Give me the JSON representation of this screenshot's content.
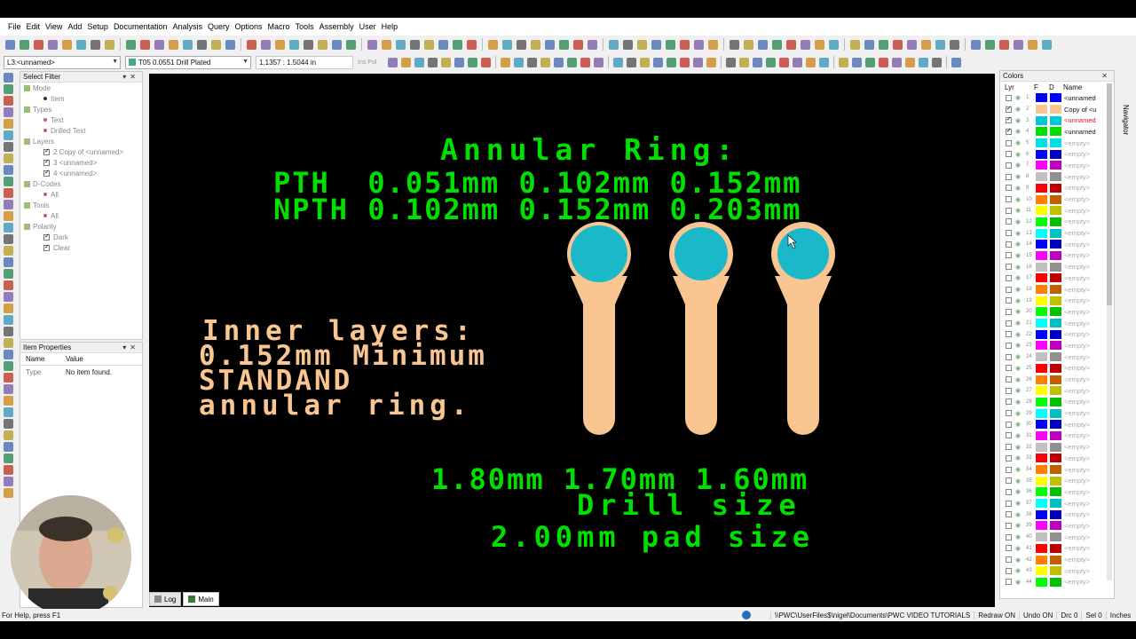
{
  "menu": [
    "File",
    "Edit",
    "View",
    "Add",
    "Setup",
    "Documentation",
    "Analysis",
    "Query",
    "Options",
    "Macro",
    "Tools",
    "Assembly",
    "User",
    "Help"
  ],
  "toolbar": {
    "layer_combo": "L3:<unnamed>",
    "tool_combo": "T05 0.0551 Drill Plated",
    "coords": "1.1357 : 1.5044 in",
    "mode_labels": "Ins  Pol"
  },
  "select_filter": {
    "title": "Select Filter",
    "rows": [
      {
        "label": "Mode",
        "level": 0,
        "kind": "group"
      },
      {
        "label": "Item",
        "level": 1,
        "kind": "radio"
      },
      {
        "label": "Types",
        "level": 0,
        "kind": "group"
      },
      {
        "label": "Text",
        "level": 1,
        "kind": "item"
      },
      {
        "label": "Drilled Text",
        "level": 1,
        "kind": "item"
      },
      {
        "label": "Layers",
        "level": 0,
        "kind": "group"
      },
      {
        "label": "2 Copy of <unnamed>",
        "level": 1,
        "kind": "check"
      },
      {
        "label": "3 <unnamed>",
        "level": 1,
        "kind": "check"
      },
      {
        "label": "4 <unnamed>",
        "level": 1,
        "kind": "check"
      },
      {
        "label": "D-Codes",
        "level": 0,
        "kind": "group"
      },
      {
        "label": "All",
        "level": 1,
        "kind": "item"
      },
      {
        "label": "Tools",
        "level": 0,
        "kind": "group"
      },
      {
        "label": "All",
        "level": 1,
        "kind": "item"
      },
      {
        "label": "Polarity",
        "level": 0,
        "kind": "group"
      },
      {
        "label": "Dark",
        "level": 1,
        "kind": "check"
      },
      {
        "label": "Clear",
        "level": 1,
        "kind": "check"
      }
    ]
  },
  "item_properties": {
    "title": "Item Properties",
    "col_name": "Name",
    "col_value": "Value",
    "row_name": "Type",
    "row_value": "No item found."
  },
  "canvas": {
    "title": "Annular Ring:",
    "line_pth": "PTH  0.051mm 0.102mm 0.152mm",
    "line_npth": "NPTH 0.102mm 0.152mm 0.203mm",
    "inner1": "Inner layers:",
    "inner2": "0.152mm Minimum",
    "inner3": "STANDAND",
    "inner4": "annular ring.",
    "drill_sizes": "1.80mm 1.70mm 1.60mm",
    "drill_label": "Drill size",
    "pad_label": "2.00mm pad size",
    "colors": {
      "text_green": "#00e000",
      "text_peach": "#f9c591",
      "pad": "#f9c591",
      "drill": "#1ab8c8"
    }
  },
  "tabs": [
    {
      "label": "Log",
      "active": false
    },
    {
      "label": "Main",
      "active": true
    }
  ],
  "colors_panel": {
    "title": "Colors",
    "headers": [
      "Lyr",
      "F",
      "D",
      "Name"
    ],
    "rows": [
      {
        "n": "1",
        "f": "#0000ff",
        "d": "#0000ff",
        "name": "<unnamed",
        "checked": false,
        "style": "dark"
      },
      {
        "n": "2",
        "f": "#f9c591",
        "d": "#f9c591",
        "name": "Copy of <u",
        "checked": true,
        "style": "dark"
      },
      {
        "n": "3",
        "f": "#00c8d8",
        "d": "#00c8d8",
        "name": "<unnamed",
        "checked": true,
        "style": "red"
      },
      {
        "n": "4",
        "f": "#00e000",
        "d": "#00e000",
        "name": "<unnamed",
        "checked": true,
        "style": "dark"
      },
      {
        "n": "5",
        "f": "#00e0e0",
        "d": "#00e0e0",
        "name": "<empty>",
        "checked": false,
        "style": "empty"
      },
      {
        "n": "6",
        "f": "#0000ff",
        "d": "#0000c0",
        "name": "<empty>",
        "checked": false,
        "style": "empty"
      },
      {
        "n": "7",
        "f": "#ff00ff",
        "d": "#c000c0",
        "name": "<empty>",
        "checked": false,
        "style": "empty"
      },
      {
        "n": "8",
        "f": "#c0c0c0",
        "d": "#909090",
        "name": "<empty>",
        "checked": false,
        "style": "empty"
      },
      {
        "n": "9",
        "f": "#ff0000",
        "d": "#c00000",
        "name": "<empty>",
        "checked": false,
        "style": "empty"
      },
      {
        "n": "10",
        "f": "#ff8000",
        "d": "#c06000",
        "name": "<empty>",
        "checked": false,
        "style": "empty"
      },
      {
        "n": "11",
        "f": "#ffff00",
        "d": "#c0c000",
        "name": "<empty>",
        "checked": false,
        "style": "empty"
      },
      {
        "n": "12",
        "f": "#00ff00",
        "d": "#00c000",
        "name": "<empty>",
        "checked": false,
        "style": "empty"
      },
      {
        "n": "13",
        "f": "#00ffff",
        "d": "#00c0c0",
        "name": "<empty>",
        "checked": false,
        "style": "empty"
      },
      {
        "n": "14",
        "f": "#0000ff",
        "d": "#0000c0",
        "name": "<empty>",
        "checked": false,
        "style": "empty"
      },
      {
        "n": "15",
        "f": "#ff00ff",
        "d": "#c000c0",
        "name": "<empty>",
        "checked": false,
        "style": "empty"
      },
      {
        "n": "16",
        "f": "#c0c0c0",
        "d": "#909090",
        "name": "<empty>",
        "checked": false,
        "style": "empty"
      },
      {
        "n": "17",
        "f": "#ff0000",
        "d": "#c00000",
        "name": "<empty>",
        "checked": false,
        "style": "empty"
      },
      {
        "n": "18",
        "f": "#ff8000",
        "d": "#c06000",
        "name": "<empty>",
        "checked": false,
        "style": "empty"
      },
      {
        "n": "19",
        "f": "#ffff00",
        "d": "#c0c000",
        "name": "<empty>",
        "checked": false,
        "style": "empty"
      },
      {
        "n": "20",
        "f": "#00ff00",
        "d": "#00c000",
        "name": "<empty>",
        "checked": false,
        "style": "empty"
      },
      {
        "n": "21",
        "f": "#00ffff",
        "d": "#00c0c0",
        "name": "<empty>",
        "checked": false,
        "style": "empty"
      },
      {
        "n": "22",
        "f": "#0000ff",
        "d": "#0000c0",
        "name": "<empty>",
        "checked": false,
        "style": "empty"
      },
      {
        "n": "23",
        "f": "#ff00ff",
        "d": "#c000c0",
        "name": "<empty>",
        "checked": false,
        "style": "empty"
      },
      {
        "n": "24",
        "f": "#c0c0c0",
        "d": "#909090",
        "name": "<empty>",
        "checked": false,
        "style": "empty"
      },
      {
        "n": "25",
        "f": "#ff0000",
        "d": "#c00000",
        "name": "<empty>",
        "checked": false,
        "style": "empty"
      },
      {
        "n": "26",
        "f": "#ff8000",
        "d": "#c06000",
        "name": "<empty>",
        "checked": false,
        "style": "empty"
      },
      {
        "n": "27",
        "f": "#ffff00",
        "d": "#c0c000",
        "name": "<empty>",
        "checked": false,
        "style": "empty"
      },
      {
        "n": "28",
        "f": "#00ff00",
        "d": "#00c000",
        "name": "<empty>",
        "checked": false,
        "style": "empty"
      },
      {
        "n": "29",
        "f": "#00ffff",
        "d": "#00c0c0",
        "name": "<empty>",
        "checked": false,
        "style": "empty"
      },
      {
        "n": "30",
        "f": "#0000ff",
        "d": "#0000c0",
        "name": "<empty>",
        "checked": false,
        "style": "empty"
      },
      {
        "n": "31",
        "f": "#ff00ff",
        "d": "#c000c0",
        "name": "<empty>",
        "checked": false,
        "style": "empty"
      },
      {
        "n": "32",
        "f": "#c0c0c0",
        "d": "#909090",
        "name": "<empty>",
        "checked": false,
        "style": "empty"
      },
      {
        "n": "33",
        "f": "#ff0000",
        "d": "#c00000",
        "name": "<empty>",
        "checked": false,
        "style": "empty"
      },
      {
        "n": "34",
        "f": "#ff8000",
        "d": "#c06000",
        "name": "<empty>",
        "checked": false,
        "style": "empty"
      },
      {
        "n": "35",
        "f": "#ffff00",
        "d": "#c0c000",
        "name": "<empty>",
        "checked": false,
        "style": "empty"
      },
      {
        "n": "36",
        "f": "#00ff00",
        "d": "#00c000",
        "name": "<empty>",
        "checked": false,
        "style": "empty"
      },
      {
        "n": "37",
        "f": "#00ffff",
        "d": "#00c0c0",
        "name": "<empty>",
        "checked": false,
        "style": "empty"
      },
      {
        "n": "38",
        "f": "#0000ff",
        "d": "#0000c0",
        "name": "<empty>",
        "checked": false,
        "style": "empty"
      },
      {
        "n": "39",
        "f": "#ff00ff",
        "d": "#c000c0",
        "name": "<empty>",
        "checked": false,
        "style": "empty"
      },
      {
        "n": "40",
        "f": "#c0c0c0",
        "d": "#909090",
        "name": "<empty>",
        "checked": false,
        "style": "empty"
      },
      {
        "n": "41",
        "f": "#ff0000",
        "d": "#c00000",
        "name": "<empty>",
        "checked": false,
        "style": "empty"
      },
      {
        "n": "42",
        "f": "#ff8000",
        "d": "#c06000",
        "name": "<empty>",
        "checked": false,
        "style": "empty"
      },
      {
        "n": "43",
        "f": "#ffff00",
        "d": "#c0c000",
        "name": "<empty>",
        "checked": false,
        "style": "empty"
      },
      {
        "n": "44",
        "f": "#00ff00",
        "d": "#00c000",
        "name": "<empty>",
        "checked": false,
        "style": "empty"
      }
    ]
  },
  "navigator_label": "Navigator",
  "status": {
    "help": "For Help, press F1",
    "path": "\\\\PWC\\UserFiles$\\nigel\\Documents\\PWC VIDEO TUTORIALS",
    "redraw": "Redraw ON",
    "undo": "Undo ON",
    "drc": "Drc 0",
    "sel": "Sel 0",
    "units": "Inches"
  }
}
